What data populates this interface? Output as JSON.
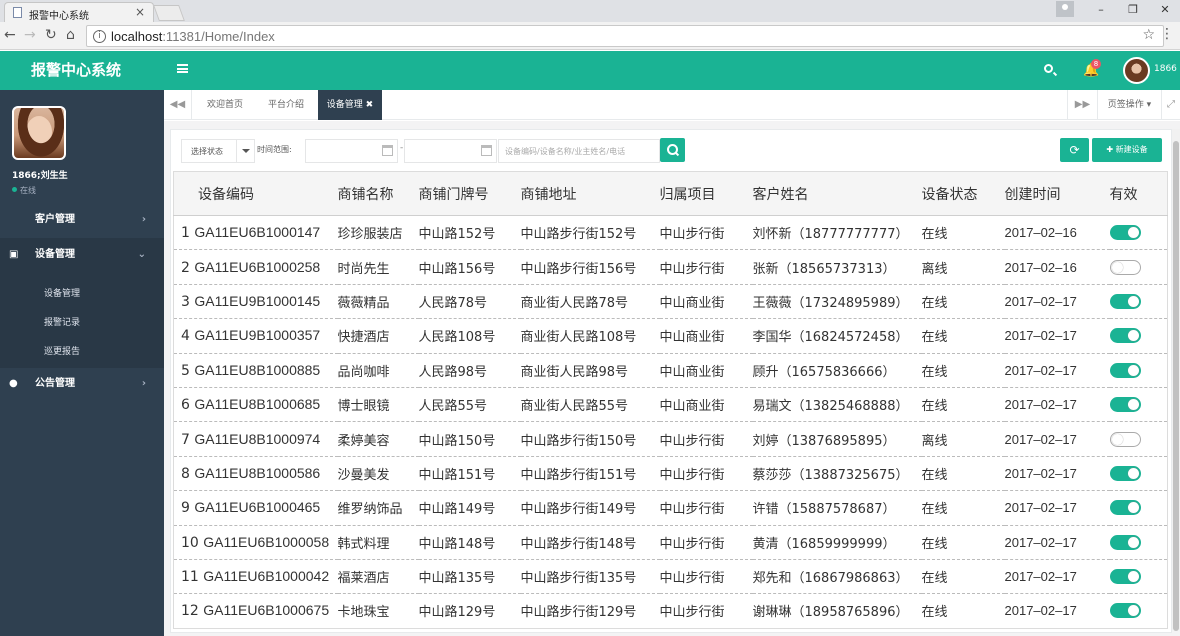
{
  "browser": {
    "tab_title": "报警中心系统",
    "tab_close": "×",
    "url_host": "localhost",
    "url_rest": ":11381/Home/Index",
    "win_min": "–",
    "win_max": "❐",
    "win_close": "✕"
  },
  "header": {
    "logo": "报警中心系统",
    "badge": "8",
    "user": "1866"
  },
  "sidebar": {
    "name": "1866;刘生生",
    "status": "在线",
    "items": [
      {
        "label": "客户管理",
        "arrow": "›"
      },
      {
        "label": "设备管理",
        "arrow": "⌄"
      },
      {
        "label": "公告管理",
        "arrow": "›"
      }
    ],
    "subitems": [
      "设备管理",
      "报警记录",
      "巡更报告"
    ]
  },
  "tabs": {
    "items": [
      "欢迎首页",
      "平台介绍",
      "设备管理 ✖"
    ],
    "ops": "页签操作 ▾"
  },
  "toolbar": {
    "status_select": "选择状态",
    "time_label": "时间范围:",
    "dash": "-",
    "search_placeholder": "设备编码/设备名称/业主姓名/电话",
    "new_button": "✚ 新建设备",
    "refresh": "⟳"
  },
  "table": {
    "columns": [
      "设备编码",
      "商铺名称",
      "商铺门牌号",
      "商铺地址",
      "归属项目",
      "客户姓名",
      "设备状态",
      "创建时间",
      "有效"
    ],
    "rows": [
      {
        "n": "1",
        "code": "GA11EU6B1000147",
        "shop": "珍珍服装店",
        "door": "中山路152号",
        "addr": "中山路步行街152号",
        "proj": "中山步行街",
        "cust": "刘怀新（18777777777）",
        "status": "在线",
        "date": "2017–02–16",
        "valid": true
      },
      {
        "n": "2",
        "code": "GA11EU6B1000258",
        "shop": "时尚先生",
        "door": "中山路156号",
        "addr": "中山路步行街156号",
        "proj": "中山步行街",
        "cust": "张新（18565737313）",
        "status": "离线",
        "date": "2017–02–16",
        "valid": false
      },
      {
        "n": "3",
        "code": "GA11EU9B1000145",
        "shop": "薇薇精品",
        "door": "人民路78号",
        "addr": "商业街人民路78号",
        "proj": "中山商业街",
        "cust": "王薇薇（17324895989）",
        "status": "在线",
        "date": "2017–02–17",
        "valid": true
      },
      {
        "n": "4",
        "code": "GA11EU9B1000357",
        "shop": "快捷酒店",
        "door": "人民路108号",
        "addr": "商业街人民路108号",
        "proj": "中山商业街",
        "cust": "李国华（16824572458）",
        "status": "在线",
        "date": "2017–02–17",
        "valid": true
      },
      {
        "n": "5",
        "code": "GA11EU8B1000885",
        "shop": "品尚咖啡",
        "door": "人民路98号",
        "addr": "商业街人民路98号",
        "proj": "中山商业街",
        "cust": "顾升（16575836666）",
        "status": "在线",
        "date": "2017–02–17",
        "valid": true
      },
      {
        "n": "6",
        "code": "GA11EU8B1000685",
        "shop": "博士眼镜",
        "door": "人民路55号",
        "addr": "商业街人民路55号",
        "proj": "中山商业街",
        "cust": "易瑞文（13825468888）",
        "status": "在线",
        "date": "2017–02–17",
        "valid": true
      },
      {
        "n": "7",
        "code": "GA11EU8B1000974",
        "shop": "柔婷美容",
        "door": "中山路150号",
        "addr": "中山路步行街150号",
        "proj": "中山步行街",
        "cust": "刘婷（13876895895）",
        "status": "离线",
        "date": "2017–02–17",
        "valid": false
      },
      {
        "n": "8",
        "code": "GA11EU8B1000586",
        "shop": "沙曼美发",
        "door": "中山路151号",
        "addr": "中山路步行街151号",
        "proj": "中山步行街",
        "cust": "蔡莎莎（13887325675）",
        "status": "在线",
        "date": "2017–02–17",
        "valid": true
      },
      {
        "n": "9",
        "code": "GA11EU6B1000465",
        "shop": "维罗纳饰品",
        "door": "中山路149号",
        "addr": "中山路步行街149号",
        "proj": "中山步行街",
        "cust": "许错（15887578687）",
        "status": "在线",
        "date": "2017–02–17",
        "valid": true
      },
      {
        "n": "10",
        "code": "GA11EU6B1000058",
        "shop": "韩式料理",
        "door": "中山路148号",
        "addr": "中山路步行街148号",
        "proj": "中山步行街",
        "cust": "黄清（16859999999）",
        "status": "在线",
        "date": "2017–02–17",
        "valid": true
      },
      {
        "n": "11",
        "code": "GA11EU6B1000042",
        "shop": "福莱酒店",
        "door": "中山路135号",
        "addr": "中山路步行街135号",
        "proj": "中山步行街",
        "cust": "郑先和（16867986863）",
        "status": "在线",
        "date": "2017–02–17",
        "valid": true
      },
      {
        "n": "12",
        "code": "GA11EU6B1000675",
        "shop": "卡地珠宝",
        "door": "中山路129号",
        "addr": "中山路步行街129号",
        "proj": "中山步行街",
        "cust": "谢琳琳（18958765896）",
        "status": "在线",
        "date": "2017–02–17",
        "valid": true
      }
    ]
  }
}
